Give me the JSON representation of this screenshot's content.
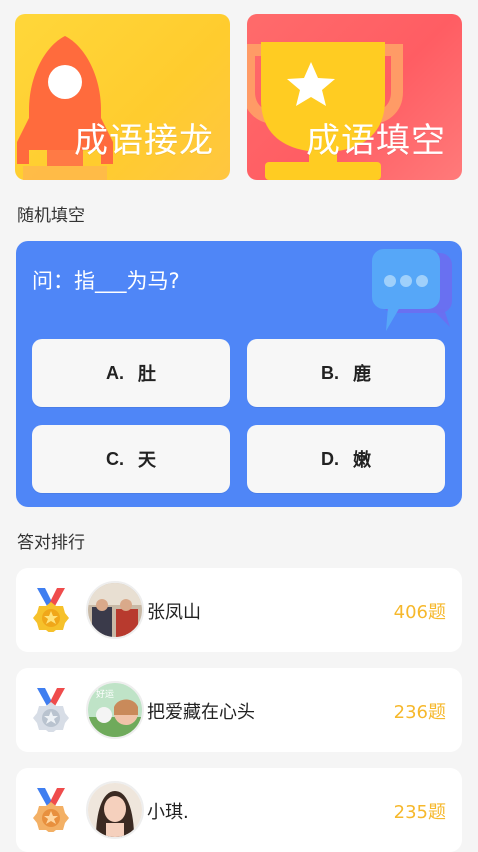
{
  "cards": [
    {
      "title": "成语接龙"
    },
    {
      "title": "成语填空"
    }
  ],
  "random_fill": {
    "section_title": "随机填空",
    "question": "问：指___为马?",
    "options": [
      {
        "letter": "A.",
        "text": "肚"
      },
      {
        "letter": "B.",
        "text": "鹿"
      },
      {
        "letter": "C.",
        "text": "天"
      },
      {
        "letter": "D.",
        "text": "嫩"
      }
    ]
  },
  "ranking": {
    "section_title": "答对排行",
    "items": [
      {
        "name": "张凤山",
        "score": "406题"
      },
      {
        "name": "把爱藏在心头",
        "score": "236题",
        "avatar_text": "好运"
      },
      {
        "name": "小琪.",
        "score": "235题"
      }
    ]
  },
  "colors": {
    "quiz_bg": "#4f86f7",
    "score": "#f6b82c",
    "card_left": "#ffd23a",
    "card_right": "#ff6168"
  }
}
